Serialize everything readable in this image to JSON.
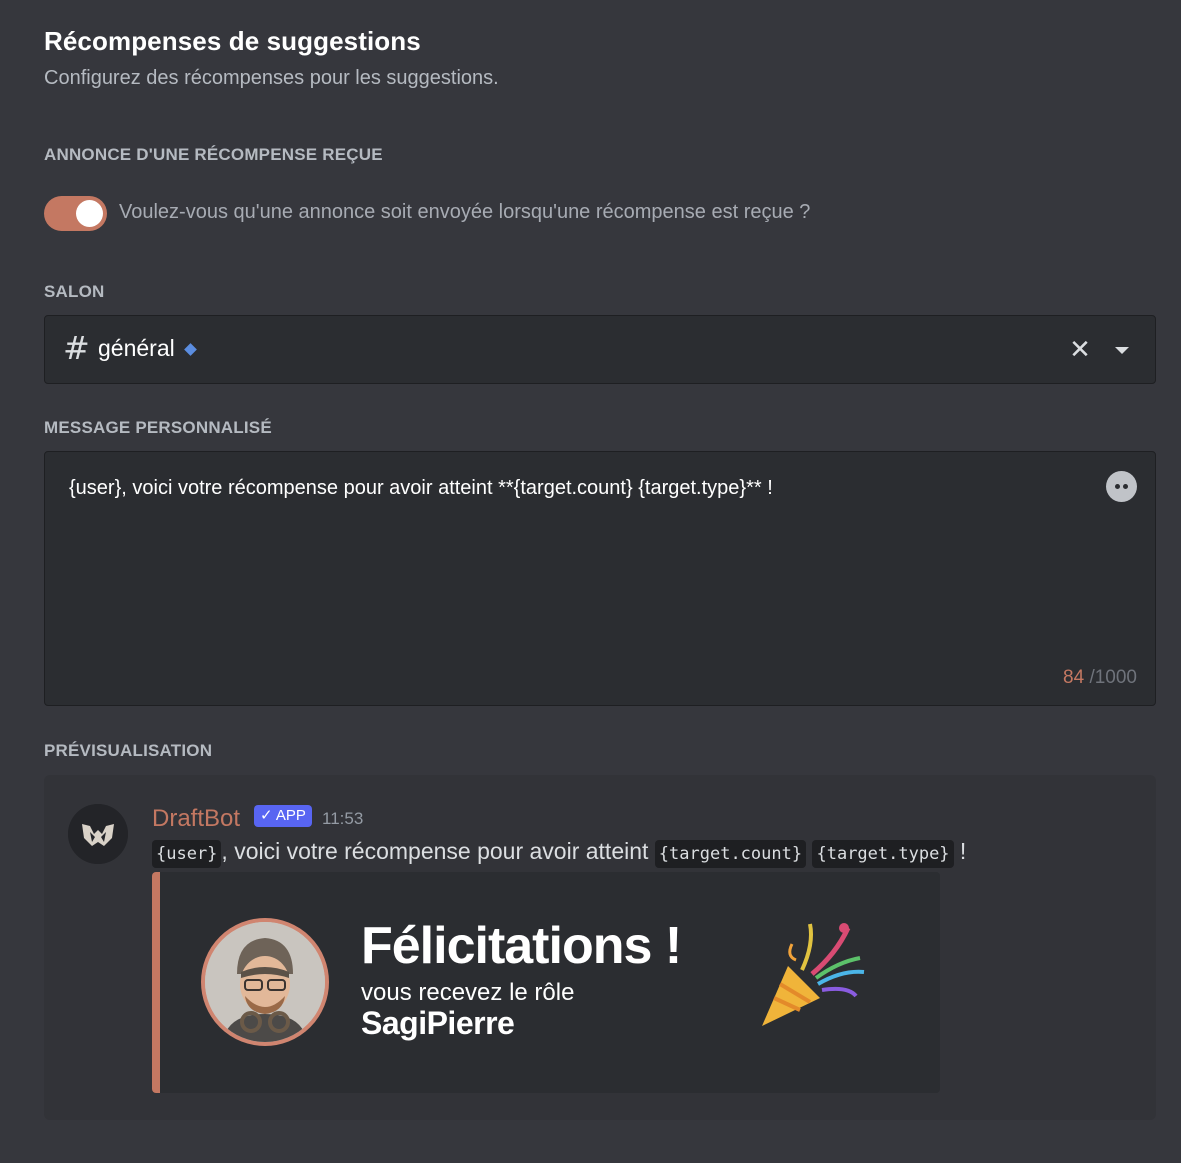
{
  "header": {
    "title": "Récompenses de suggestions",
    "subtitle": "Configurez des récompenses pour les suggestions."
  },
  "announce": {
    "label": "ANNONCE D'UNE RÉCOMPENSE REÇUE",
    "toggle_enabled": true,
    "toggle_text": "Voulez-vous qu'une annonce soit envoyée lorsqu'une récompense est reçue ?"
  },
  "channel": {
    "label": "SALON",
    "value": "général",
    "prefix": "#"
  },
  "message": {
    "label": "MESSAGE PERSONNALISÉ",
    "value": "{user}, voici votre récompense pour avoir atteint **{target.count} {target.type}** !",
    "count": "84",
    "max": "/1000"
  },
  "preview": {
    "label": "PRÉVISUALISATION",
    "bot_name": "DraftBot",
    "badge": "✓ APP",
    "time": "11:53",
    "msg_user": "{user}",
    "msg_text": ", voici votre récompense pour avoir atteint ",
    "msg_count": "{target.count}",
    "msg_type": "{target.type}",
    "msg_end": " !",
    "embed": {
      "title": "Félicitations !",
      "subtitle": "vous recevez le rôle",
      "role": "SagiPierre"
    }
  },
  "colors": {
    "accent": "#c47862",
    "background": "#36373d",
    "input": "#2b2d31",
    "badge": "#5865f2"
  }
}
